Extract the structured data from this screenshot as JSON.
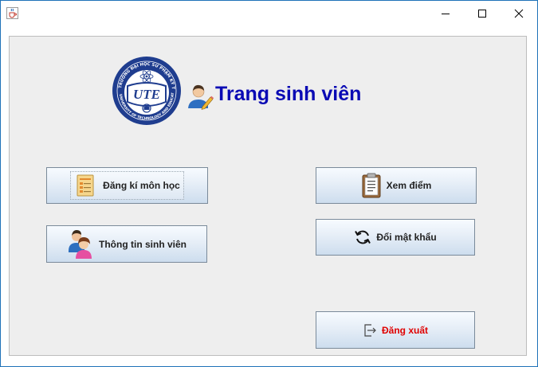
{
  "window": {
    "controls": {
      "minimize": "minimize",
      "maximize": "maximize",
      "close": "close"
    }
  },
  "header": {
    "logo": {
      "arc_text": "TRƯỜNG ĐẠI HỌC SƯ PHẠM KỸ THUẬT · UNIVERSITY OF TECHNOLOGY AND EDUCATION",
      "monogram": "UTE"
    },
    "title": "Trang sinh viên"
  },
  "buttons": {
    "register": {
      "label": "Đăng kí môn học",
      "icon": "form-document-icon"
    },
    "student_info": {
      "label": "Thông tin sinh viên",
      "icon": "users-icon"
    },
    "grades": {
      "label": "Xem điểm",
      "icon": "clipboard-icon"
    },
    "change_password": {
      "label": "Đổi mật khẩu",
      "icon": "refresh-icon"
    },
    "logout": {
      "label": "Đăng xuất",
      "icon": "exit-icon"
    }
  },
  "colors": {
    "title": "#0a0ab4",
    "logout_label": "#e00000",
    "panel_bg": "#eeeeee",
    "window_border": "#1f72b8",
    "logo_blue": "#1f3d8f"
  }
}
